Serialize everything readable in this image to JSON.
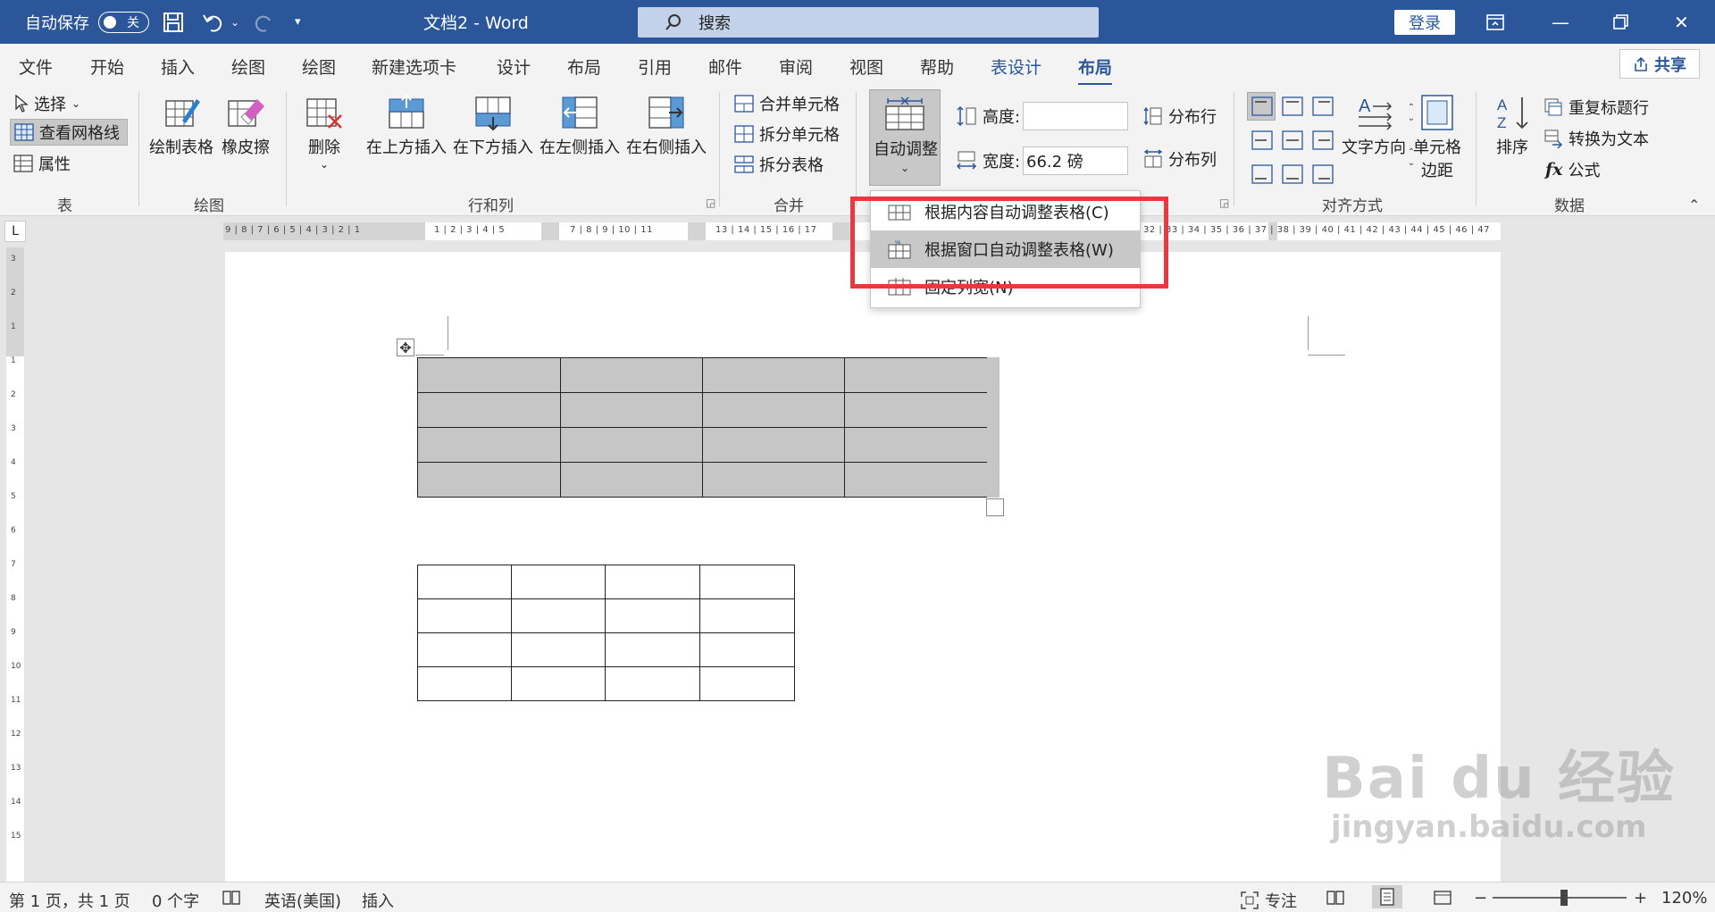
{
  "titlebar": {
    "autosave_label": "自动保存",
    "autosave_state": "关",
    "doc_title": "文档2  -  Word",
    "search_placeholder": "搜索",
    "login_label": "登录"
  },
  "tabs": [
    "文件",
    "开始",
    "插入",
    "绘图",
    "绘图",
    "新建选项卡",
    "设计",
    "布局",
    "引用",
    "邮件",
    "审阅",
    "视图",
    "帮助",
    "表设计",
    "布局"
  ],
  "share_label": "共享",
  "ribbon": {
    "table_group": {
      "select": "选择",
      "view_gridlines": "查看网格线",
      "properties": "属性",
      "label": "表"
    },
    "draw_group": {
      "draw_table": "绘制表格",
      "eraser": "橡皮擦",
      "label": "绘图"
    },
    "rows_cols_group": {
      "delete": "删除",
      "insert_above": "在上方插入",
      "insert_below": "在下方插入",
      "insert_left": "在左侧插入",
      "insert_right": "在右侧插入",
      "label": "行和列"
    },
    "merge_group": {
      "merge_cells": "合并单元格",
      "split_cells": "拆分单元格",
      "split_table": "拆分表格",
      "label": "合并"
    },
    "cell_size_group": {
      "autofit": "自动调整",
      "height_label": "高度:",
      "height_value": "",
      "width_label": "宽度:",
      "width_value": "66.2 磅",
      "distribute_rows": "分布行",
      "distribute_cols": "分布列"
    },
    "alignment_group": {
      "text_direction": "文字方向",
      "cell_margins_1": "单元格",
      "cell_margins_2": "边距",
      "label": "对齐方式"
    },
    "data_group": {
      "sort": "排序",
      "repeat_header": "重复标题行",
      "convert_text": "转换为文本",
      "formula": "公式",
      "label": "数据"
    }
  },
  "ruler": {
    "h_left": "9 | 8 | 7 | 6 | 5 | 4 | 3 | 2 | 1",
    "h_mid1": "1 | 2 | 3 | 4 | 5",
    "h_mid2": "7 | 8 | 9 | 10 | 11",
    "h_mid3": "13 | 14 | 15 | 16 | 17",
    "h_right": "32 | 33 | 34 | 35 | 36 | 37 | 38 | 39 | 40 | 41 | 42 | 43 | 44 | 45 | 46 | 47",
    "v_marks": [
      "3",
      "2",
      "1",
      "1",
      "2",
      "3",
      "4",
      "5",
      "6",
      "7",
      "8",
      "9",
      "10",
      "11",
      "12",
      "13",
      "14",
      "15"
    ]
  },
  "autofit_menu": {
    "items": [
      "根据内容自动调整表格(C)",
      "根据窗口自动调整表格(W)",
      "固定列宽(N)"
    ]
  },
  "document": {
    "table1": {
      "rows": 4,
      "cols": 4
    },
    "table2": {
      "rows": 4,
      "cols": 4
    }
  },
  "statusbar": {
    "page": "第 1 页，共 1 页",
    "words": "0 个字",
    "language": "英语(美国)",
    "mode": "插入",
    "focus": "专注",
    "zoom": "120%"
  },
  "watermark": {
    "line1": "Bai du 经验",
    "line2": "jingyan.baidu.com"
  },
  "colors": {
    "titlebar": "#2b579a",
    "highlight": "#e8393f",
    "selected_cells": "#c6c6c6"
  }
}
